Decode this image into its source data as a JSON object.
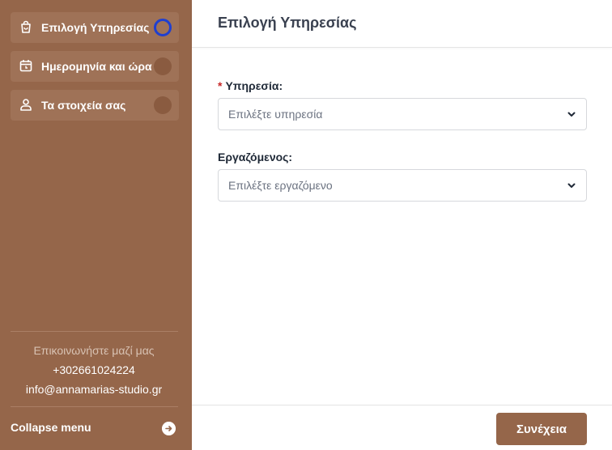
{
  "sidebar": {
    "steps": [
      {
        "label": "Επιλογή Υπηρεσίας",
        "icon": "shopping-bag-icon",
        "active": true
      },
      {
        "label": "Ημερομηνία και ώρα",
        "icon": "calendar-icon",
        "active": false
      },
      {
        "label": "Τα στοιχεία σας",
        "icon": "user-icon",
        "active": false
      }
    ],
    "contact": {
      "title": "Επικοινωνήστε μαζί μας",
      "phone": "+302661024224",
      "email": "info@annamarias-studio.gr"
    },
    "collapse_label": "Collapse menu"
  },
  "main": {
    "title": "Επιλογή Υπηρεσίας",
    "service": {
      "required_mark": "*",
      "label": "Υπηρεσία:",
      "placeholder": "Επιλέξτε υπηρεσία"
    },
    "employee": {
      "label": "Εργαζόμενος:",
      "placeholder": "Επιλέξτε εργαζόμενο"
    },
    "next_label": "Συνέχεια"
  },
  "colors": {
    "brand": "#95664a",
    "active_ring": "#1f3fd0",
    "required": "#c62828"
  }
}
